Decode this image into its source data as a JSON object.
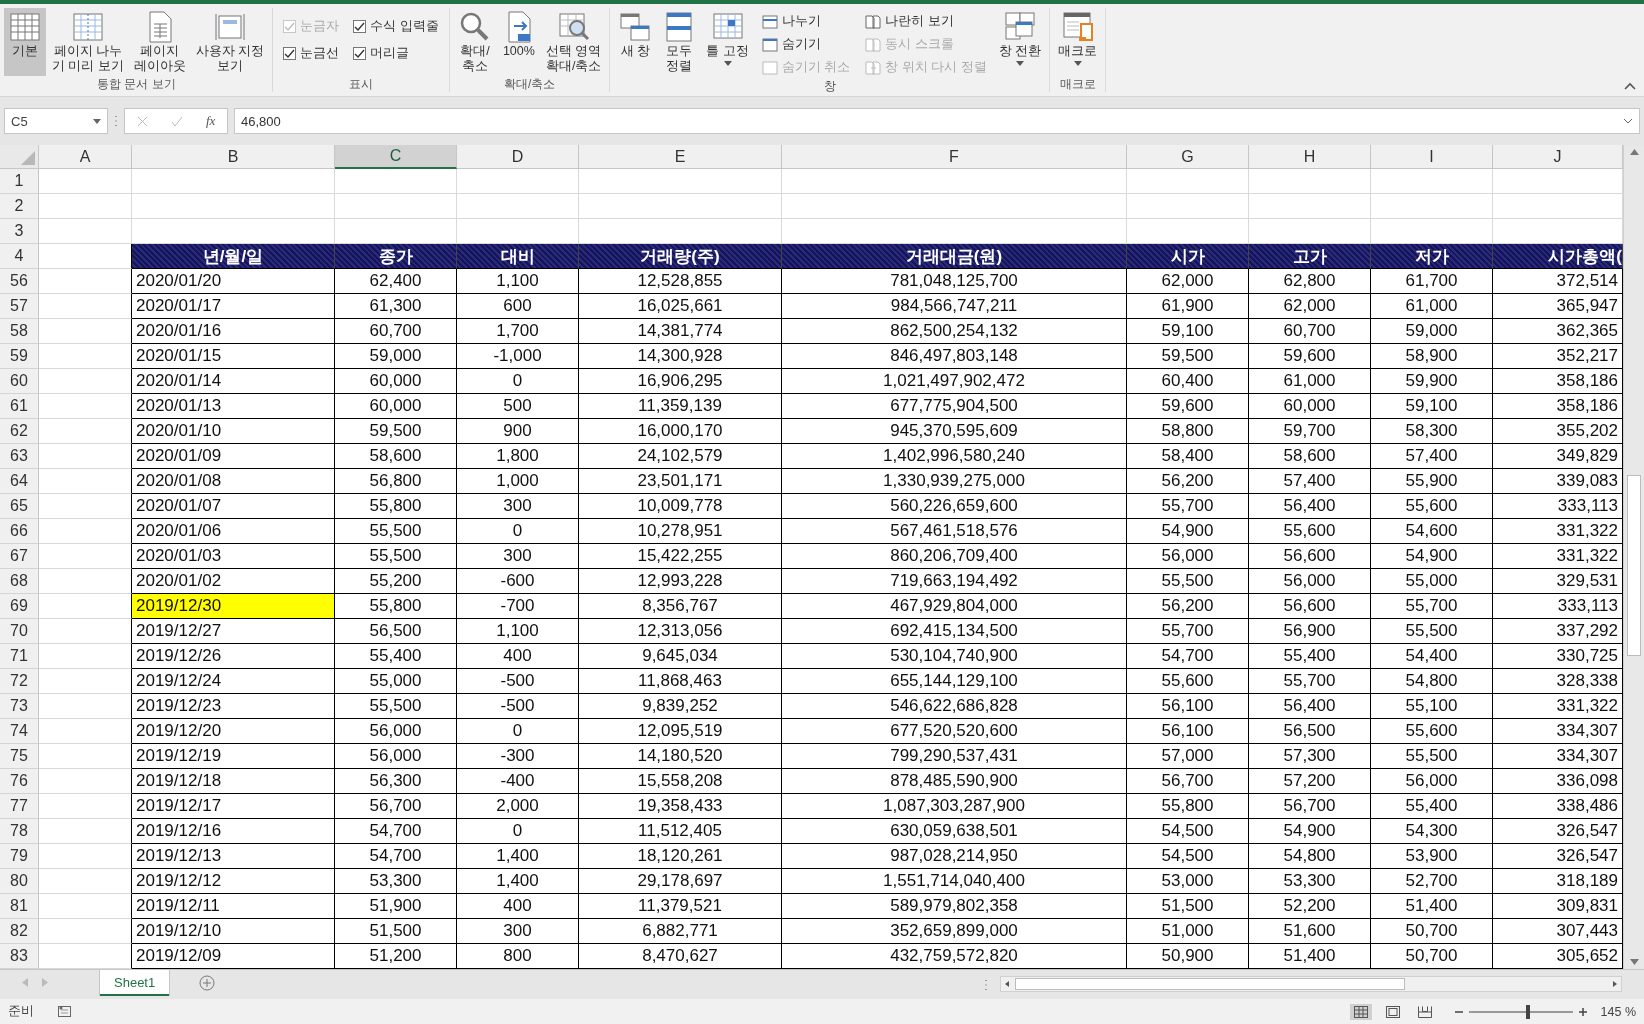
{
  "ribbon": {
    "groups": [
      {
        "label": "통합 문서 보기",
        "items": [
          {
            "kind": "large",
            "lines": [
              "기본"
            ],
            "selected": true,
            "dropdown": false
          },
          {
            "kind": "large",
            "lines": [
              "페이지 나누",
              "기 미리 보기"
            ],
            "selected": false,
            "dropdown": false
          },
          {
            "kind": "large",
            "lines": [
              "페이지",
              "레이아웃"
            ],
            "selected": false,
            "dropdown": false
          },
          {
            "kind": "large",
            "lines": [
              "사용자 지정",
              "보기"
            ],
            "selected": false,
            "dropdown": false
          }
        ]
      },
      {
        "label": "표시",
        "items": [
          {
            "kind": "checks",
            "boxes": [
              {
                "label": "눈금자",
                "checked": true,
                "disabled": true
              },
              {
                "label": "수식 입력줄",
                "checked": true,
                "disabled": false
              },
              {
                "label": "눈금선",
                "checked": true,
                "disabled": false
              },
              {
                "label": "머리글",
                "checked": true,
                "disabled": false
              }
            ]
          }
        ]
      },
      {
        "label": "확대/축소",
        "items": [
          {
            "kind": "large",
            "lines": [
              "확대/",
              "축소"
            ],
            "selected": false,
            "dropdown": false
          },
          {
            "kind": "large",
            "lines": [
              "100%"
            ],
            "selected": false,
            "dropdown": false
          },
          {
            "kind": "large",
            "lines": [
              "선택 영역",
              "확대/축소"
            ],
            "selected": false,
            "dropdown": false
          }
        ]
      },
      {
        "label": "창",
        "items": [
          {
            "kind": "large",
            "lines": [
              "새 창"
            ],
            "selected": false,
            "dropdown": false
          },
          {
            "kind": "large",
            "lines": [
              "모두",
              "정렬"
            ],
            "selected": false,
            "dropdown": false
          },
          {
            "kind": "large",
            "lines": [
              "틀 고정"
            ],
            "selected": false,
            "dropdown": true
          },
          {
            "kind": "stack",
            "entries": [
              {
                "label": "나누기",
                "disabled": false
              },
              {
                "label": "숨기기",
                "disabled": false
              },
              {
                "label": "숨기기 취소",
                "disabled": true
              }
            ]
          },
          {
            "kind": "stack",
            "entries": [
              {
                "label": "나란히 보기",
                "disabled": false
              },
              {
                "label": "동시 스크롤",
                "disabled": true
              },
              {
                "label": "창 위치 다시 정렬",
                "disabled": true
              }
            ]
          },
          {
            "kind": "large",
            "lines": [
              "창 전환"
            ],
            "selected": false,
            "dropdown": true
          }
        ]
      },
      {
        "label": "매크로",
        "items": [
          {
            "kind": "large",
            "lines": [
              "매크로"
            ],
            "selected": false,
            "dropdown": true
          }
        ]
      }
    ]
  },
  "formula_bar": {
    "name_box": "C5",
    "function_label": "fx",
    "value": "46,800"
  },
  "sheet": {
    "columns": [
      {
        "label": "A",
        "selected": false
      },
      {
        "label": "B",
        "selected": false
      },
      {
        "label": "C",
        "selected": true
      },
      {
        "label": "D",
        "selected": false
      },
      {
        "label": "E",
        "selected": false
      },
      {
        "label": "F",
        "selected": false
      },
      {
        "label": "G",
        "selected": false
      },
      {
        "label": "H",
        "selected": false
      },
      {
        "label": "I",
        "selected": false
      },
      {
        "label": "J",
        "selected": false
      }
    ],
    "top_rows": [
      "1",
      "2",
      "3"
    ],
    "header_row": {
      "number": "4",
      "cells": [
        "",
        "년/월/일",
        "종가",
        "대비",
        "거래량(주)",
        "거래대금(원)",
        "시가",
        "고가",
        "저가",
        "시가총액("
      ]
    },
    "rows": [
      {
        "number": "56",
        "highlighted": false,
        "cells": [
          "",
          "2020/01/20",
          "62,400",
          "1,100",
          "12,528,855",
          "781,048,125,700",
          "62,000",
          "62,800",
          "61,700",
          "372,514"
        ]
      },
      {
        "number": "57",
        "highlighted": false,
        "cells": [
          "",
          "2020/01/17",
          "61,300",
          "600",
          "16,025,661",
          "984,566,747,211",
          "61,900",
          "62,000",
          "61,000",
          "365,947"
        ]
      },
      {
        "number": "58",
        "highlighted": false,
        "cells": [
          "",
          "2020/01/16",
          "60,700",
          "1,700",
          "14,381,774",
          "862,500,254,132",
          "59,100",
          "60,700",
          "59,000",
          "362,365"
        ]
      },
      {
        "number": "59",
        "highlighted": false,
        "cells": [
          "",
          "2020/01/15",
          "59,000",
          "-1,000",
          "14,300,928",
          "846,497,803,148",
          "59,500",
          "59,600",
          "58,900",
          "352,217"
        ]
      },
      {
        "number": "60",
        "highlighted": false,
        "cells": [
          "",
          "2020/01/14",
          "60,000",
          "0",
          "16,906,295",
          "1,021,497,902,472",
          "60,400",
          "61,000",
          "59,900",
          "358,186"
        ]
      },
      {
        "number": "61",
        "highlighted": false,
        "cells": [
          "",
          "2020/01/13",
          "60,000",
          "500",
          "11,359,139",
          "677,775,904,500",
          "59,600",
          "60,000",
          "59,100",
          "358,186"
        ]
      },
      {
        "number": "62",
        "highlighted": false,
        "cells": [
          "",
          "2020/01/10",
          "59,500",
          "900",
          "16,000,170",
          "945,370,595,609",
          "58,800",
          "59,700",
          "58,300",
          "355,202"
        ]
      },
      {
        "number": "63",
        "highlighted": false,
        "cells": [
          "",
          "2020/01/09",
          "58,600",
          "1,800",
          "24,102,579",
          "1,402,996,580,240",
          "58,400",
          "58,600",
          "57,400",
          "349,829"
        ]
      },
      {
        "number": "64",
        "highlighted": false,
        "cells": [
          "",
          "2020/01/08",
          "56,800",
          "1,000",
          "23,501,171",
          "1,330,939,275,000",
          "56,200",
          "57,400",
          "55,900",
          "339,083"
        ]
      },
      {
        "number": "65",
        "highlighted": false,
        "cells": [
          "",
          "2020/01/07",
          "55,800",
          "300",
          "10,009,778",
          "560,226,659,600",
          "55,700",
          "56,400",
          "55,600",
          "333,113"
        ]
      },
      {
        "number": "66",
        "highlighted": false,
        "cells": [
          "",
          "2020/01/06",
          "55,500",
          "0",
          "10,278,951",
          "567,461,518,576",
          "54,900",
          "55,600",
          "54,600",
          "331,322"
        ]
      },
      {
        "number": "67",
        "highlighted": false,
        "cells": [
          "",
          "2020/01/03",
          "55,500",
          "300",
          "15,422,255",
          "860,206,709,400",
          "56,000",
          "56,600",
          "54,900",
          "331,322"
        ]
      },
      {
        "number": "68",
        "highlighted": false,
        "cells": [
          "",
          "2020/01/02",
          "55,200",
          "-600",
          "12,993,228",
          "719,663,194,492",
          "55,500",
          "56,000",
          "55,000",
          "329,531"
        ]
      },
      {
        "number": "69",
        "highlighted": true,
        "cells": [
          "",
          "2019/12/30",
          "55,800",
          "-700",
          "8,356,767",
          "467,929,804,000",
          "56,200",
          "56,600",
          "55,700",
          "333,113"
        ]
      },
      {
        "number": "70",
        "highlighted": false,
        "cells": [
          "",
          "2019/12/27",
          "56,500",
          "1,100",
          "12,313,056",
          "692,415,134,500",
          "55,700",
          "56,900",
          "55,500",
          "337,292"
        ]
      },
      {
        "number": "71",
        "highlighted": false,
        "cells": [
          "",
          "2019/12/26",
          "55,400",
          "400",
          "9,645,034",
          "530,104,740,900",
          "54,700",
          "55,400",
          "54,400",
          "330,725"
        ]
      },
      {
        "number": "72",
        "highlighted": false,
        "cells": [
          "",
          "2019/12/24",
          "55,000",
          "-500",
          "11,868,463",
          "655,144,129,100",
          "55,600",
          "55,700",
          "54,800",
          "328,338"
        ]
      },
      {
        "number": "73",
        "highlighted": false,
        "cells": [
          "",
          "2019/12/23",
          "55,500",
          "-500",
          "9,839,252",
          "546,622,686,828",
          "56,100",
          "56,400",
          "55,100",
          "331,322"
        ]
      },
      {
        "number": "74",
        "highlighted": false,
        "cells": [
          "",
          "2019/12/20",
          "56,000",
          "0",
          "12,095,519",
          "677,520,520,600",
          "56,100",
          "56,500",
          "55,600",
          "334,307"
        ]
      },
      {
        "number": "75",
        "highlighted": false,
        "cells": [
          "",
          "2019/12/19",
          "56,000",
          "-300",
          "14,180,520",
          "799,290,537,431",
          "57,000",
          "57,300",
          "55,500",
          "334,307"
        ]
      },
      {
        "number": "76",
        "highlighted": false,
        "cells": [
          "",
          "2019/12/18",
          "56,300",
          "-400",
          "15,558,208",
          "878,485,590,900",
          "56,700",
          "57,200",
          "56,000",
          "336,098"
        ]
      },
      {
        "number": "77",
        "highlighted": false,
        "cells": [
          "",
          "2019/12/17",
          "56,700",
          "2,000",
          "19,358,433",
          "1,087,303,287,900",
          "55,800",
          "56,700",
          "55,400",
          "338,486"
        ]
      },
      {
        "number": "78",
        "highlighted": false,
        "cells": [
          "",
          "2019/12/16",
          "54,700",
          "0",
          "11,512,405",
          "630,059,638,501",
          "54,500",
          "54,900",
          "54,300",
          "326,547"
        ]
      },
      {
        "number": "79",
        "highlighted": false,
        "cells": [
          "",
          "2019/12/13",
          "54,700",
          "1,400",
          "18,120,261",
          "987,028,214,950",
          "54,500",
          "54,800",
          "53,900",
          "326,547"
        ]
      },
      {
        "number": "80",
        "highlighted": false,
        "cells": [
          "",
          "2019/12/12",
          "53,300",
          "1,400",
          "29,178,697",
          "1,551,714,040,400",
          "53,000",
          "53,300",
          "52,700",
          "318,189"
        ]
      },
      {
        "number": "81",
        "highlighted": false,
        "cells": [
          "",
          "2019/12/11",
          "51,900",
          "400",
          "11,379,521",
          "589,979,802,358",
          "51,500",
          "52,200",
          "51,400",
          "309,831"
        ]
      },
      {
        "number": "82",
        "highlighted": false,
        "cells": [
          "",
          "2019/12/10",
          "51,500",
          "300",
          "6,882,771",
          "352,659,899,000",
          "51,000",
          "51,600",
          "50,700",
          "307,443"
        ]
      },
      {
        "number": "83",
        "highlighted": false,
        "cells": [
          "",
          "2019/12/09",
          "51,200",
          "800",
          "8,470,627",
          "432,759,572,820",
          "50,900",
          "51,400",
          "50,700",
          "305,652"
        ]
      }
    ]
  },
  "sheet_tabs": [
    {
      "label": "Sheet1",
      "selected": true
    }
  ],
  "status_bar": {
    "text": "준비",
    "views": [
      {
        "kind": "normal",
        "selected": true
      },
      {
        "kind": "page_layout",
        "selected": false
      },
      {
        "kind": "page_break",
        "selected": false
      }
    ],
    "zoom": {
      "level": 0.57,
      "reading": "145 %"
    }
  }
}
